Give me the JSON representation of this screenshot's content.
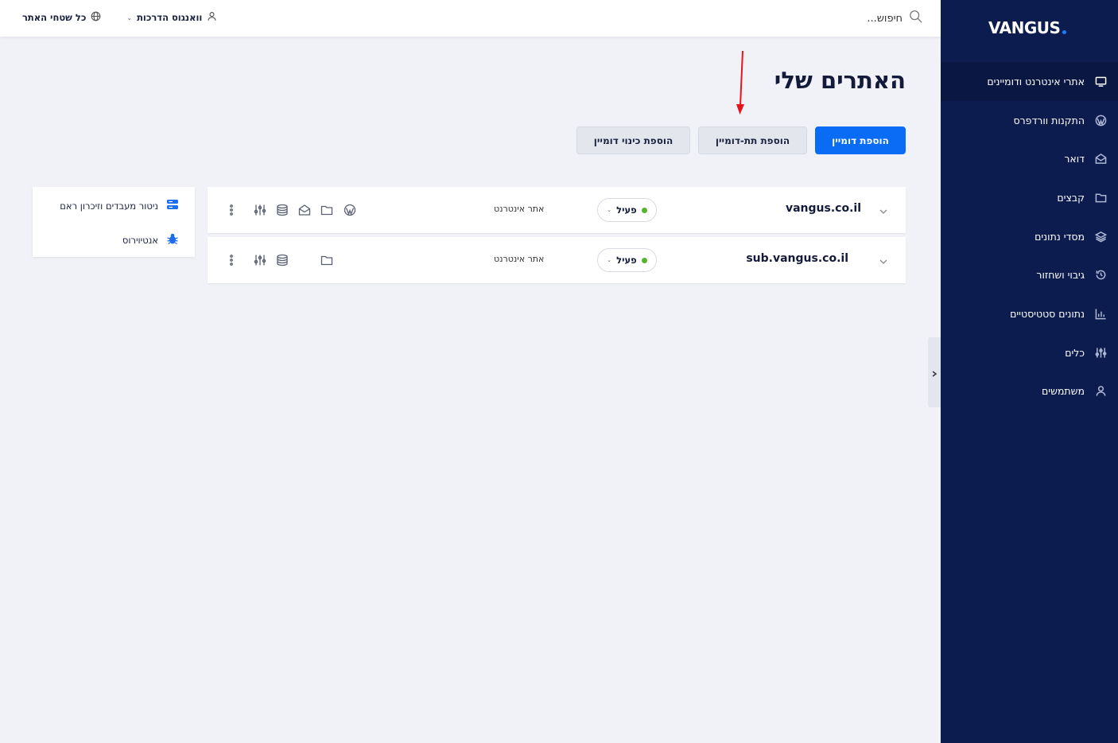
{
  "sidebar": {
    "logo": "VANGUS",
    "items": [
      {
        "label": "אתרי אינטרנט ודומיינים",
        "icon": "monitor-icon"
      },
      {
        "label": "התקנות וורדפרס",
        "icon": "wordpress-icon"
      },
      {
        "label": "דואר",
        "icon": "mail-icon"
      },
      {
        "label": "קבצים",
        "icon": "folder-icon"
      },
      {
        "label": "מסדי נתונים",
        "icon": "layers-icon"
      },
      {
        "label": "גיבוי ושחזור",
        "icon": "history-icon"
      },
      {
        "label": "נתונים סטטיסטיים",
        "icon": "chart-icon"
      },
      {
        "label": "כלים",
        "icon": "sliders-icon"
      },
      {
        "label": "משתמשים",
        "icon": "user-icon"
      }
    ]
  },
  "topbar": {
    "search_placeholder": "חיפוש...",
    "user_label": "וואנגוס הדרכות",
    "scope_label": "כל שטחי האתר"
  },
  "page": {
    "title": "האתרים שלי"
  },
  "actions": {
    "add_domain": "הוספת דומיין",
    "add_subdomain": "הוספת תת-דומיין",
    "add_alias": "הוספת כינוי דומיין"
  },
  "domains": [
    {
      "name": "vangus.co.il",
      "status": "פעיל",
      "type": "אתר אינטרנט"
    },
    {
      "name": "sub.vangus.co.il",
      "status": "פעיל",
      "type": "אתר אינטרנט"
    }
  ],
  "side_panel": {
    "monitor_label": "ניטור מעבדים וזיכרון ראם",
    "antivirus_label": "אנטיוירוס"
  },
  "colors": {
    "sidebar_bg": "#0c1c4f",
    "primary": "#0a6cf5",
    "status_active": "#52b52a",
    "arrow": "#e8141c"
  }
}
